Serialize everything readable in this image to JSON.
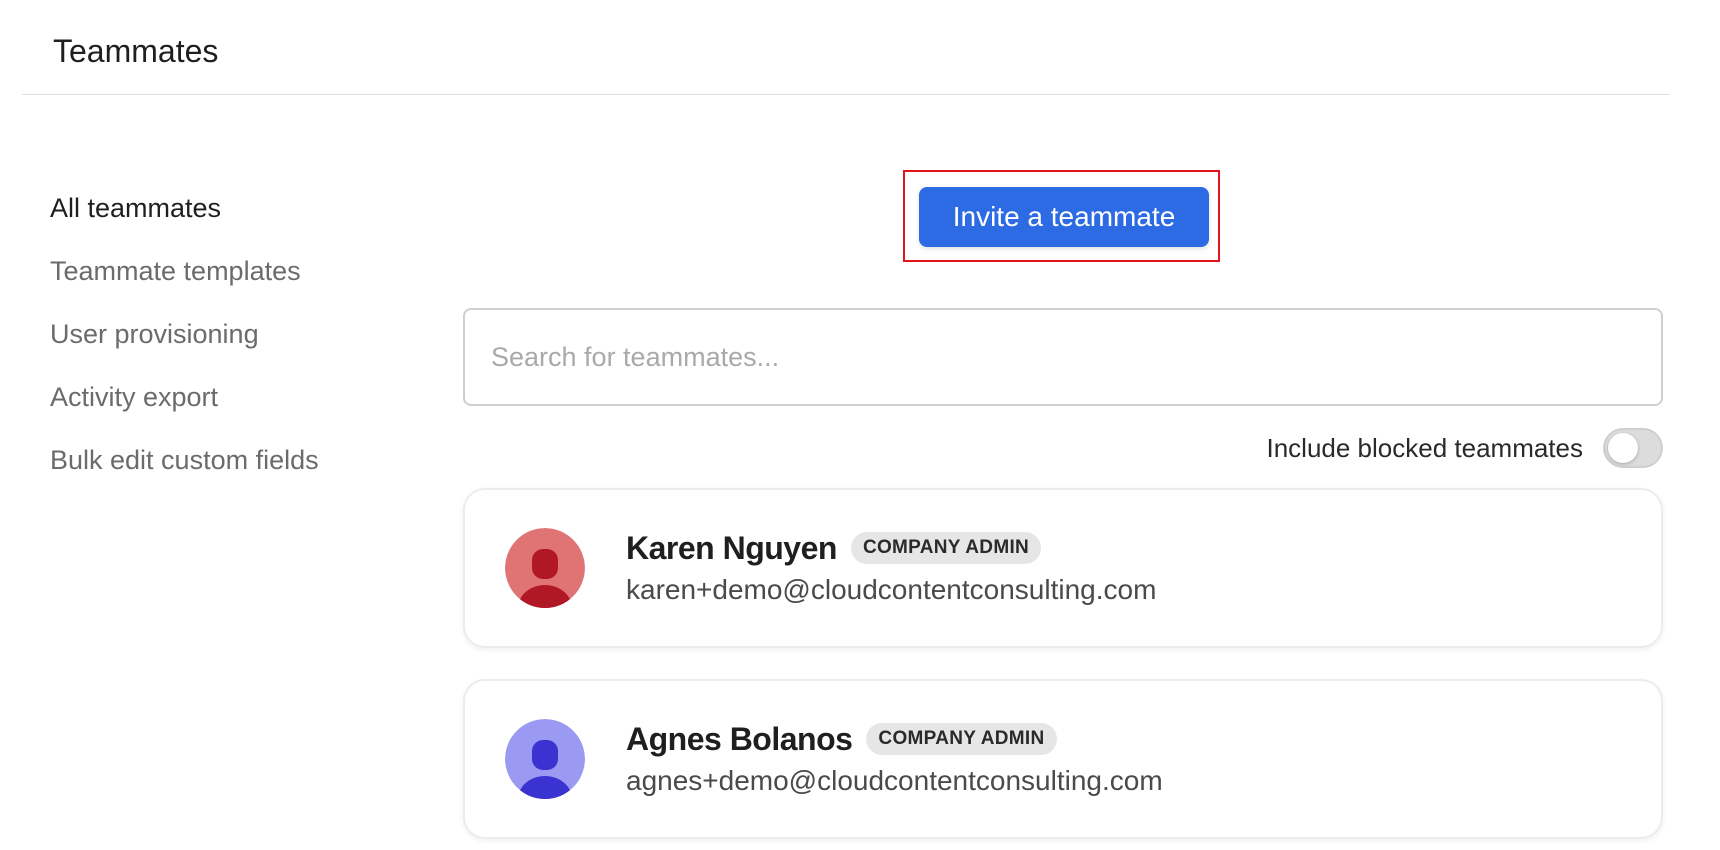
{
  "header": {
    "title": "Teammates"
  },
  "sidebar": {
    "items": [
      {
        "label": "All teammates",
        "active": true
      },
      {
        "label": "Teammate templates"
      },
      {
        "label": "User provisioning"
      },
      {
        "label": "Activity export"
      },
      {
        "label": "Bulk edit custom fields"
      }
    ]
  },
  "actions": {
    "invite_label": "Invite a teammate"
  },
  "search": {
    "placeholder": "Search for teammates...",
    "value": ""
  },
  "filters": {
    "include_blocked_label": "Include blocked teammates",
    "include_blocked_on": false
  },
  "teammates": [
    {
      "name": "Karen Nguyen",
      "role": "COMPANY ADMIN",
      "email": "karen+demo@cloudcontentconsulting.com",
      "avatar_bg": "#e07474",
      "avatar_fg": "#b01826"
    },
    {
      "name": "Agnes Bolanos",
      "role": "COMPANY ADMIN",
      "email": "agnes+demo@cloudcontentconsulting.com",
      "avatar_bg": "#9a9af2",
      "avatar_fg": "#3b33d1"
    }
  ],
  "colors": {
    "accent": "#2d6be4",
    "highlight": "#e2141a"
  }
}
